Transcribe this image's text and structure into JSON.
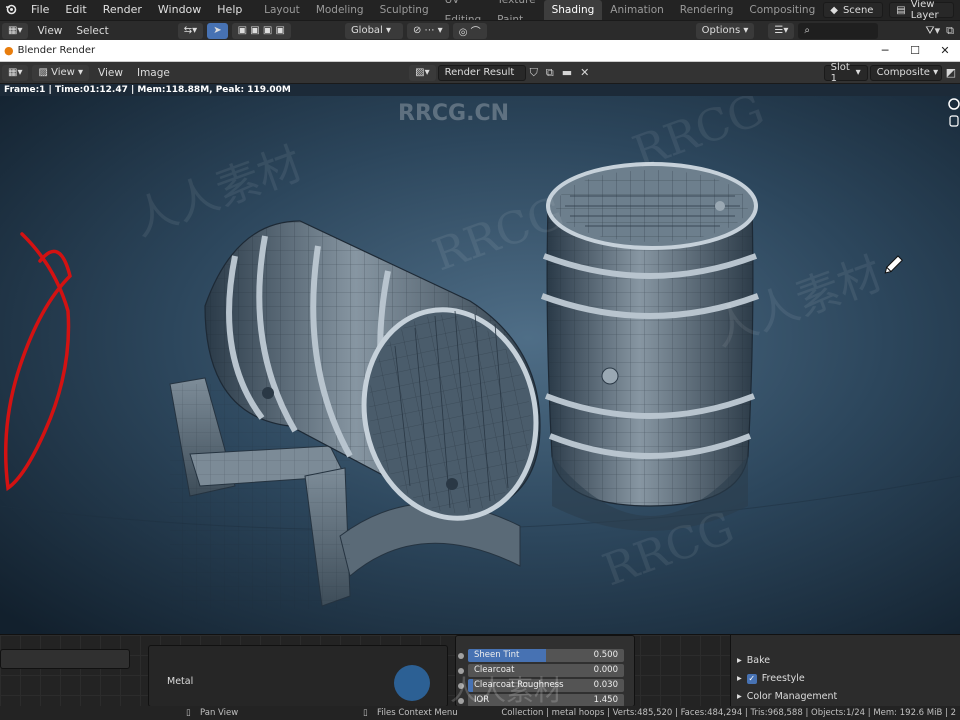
{
  "menubar": {
    "menus": [
      "File",
      "Edit",
      "Render",
      "Window",
      "Help"
    ],
    "workspaces": [
      "Layout",
      "Modeling",
      "Sculpting",
      "UV Editing",
      "Texture Paint",
      "Shading",
      "Animation",
      "Rendering",
      "Compositing"
    ],
    "active_workspace": "Shading",
    "scene": "Scene",
    "view_layer": "View Layer"
  },
  "toolbar": {
    "view": "View",
    "select": "Select",
    "orientation": "Global",
    "options": "Options"
  },
  "render_window": {
    "title": "Blender Render"
  },
  "image_header": {
    "view_menu": "View",
    "view": "View",
    "image": "Image",
    "image_name": "Render Result",
    "slot": "Slot 1",
    "pass": "Composite"
  },
  "render_info": "Frame:1 | Time:01:12.47 | Mem:118.88M, Peak: 119.00M",
  "node_editor": {
    "material_label": "Metal",
    "properties": [
      {
        "label": "Sheen Tint",
        "value": "0.500",
        "fill": 0.5
      },
      {
        "label": "Clearcoat",
        "value": "0.000",
        "fill": 0.0
      },
      {
        "label": "Clearcoat Roughness",
        "value": "0.030",
        "fill": 0.03
      },
      {
        "label": "IOR",
        "value": "1.450",
        "fill": 0.0
      }
    ]
  },
  "render_properties": {
    "bake": "Bake",
    "freestyle": "Freestyle",
    "color_management": "Color Management"
  },
  "statusbar": {
    "pan_view": "Pan View",
    "context_menu": "Files Context Menu",
    "stats": "Collection | metal hoops | Verts:485,520 | Faces:484,294 | Tris:968,588 | Objects:1/24 | Mem: 192.6 MiB | 2"
  },
  "watermarks": [
    "RRCG.CN",
    "RRCG",
    "人人素材"
  ],
  "colors": {
    "accent": "#4772b3",
    "annotation": "#d31212",
    "render_bg": "#1c2a38"
  }
}
